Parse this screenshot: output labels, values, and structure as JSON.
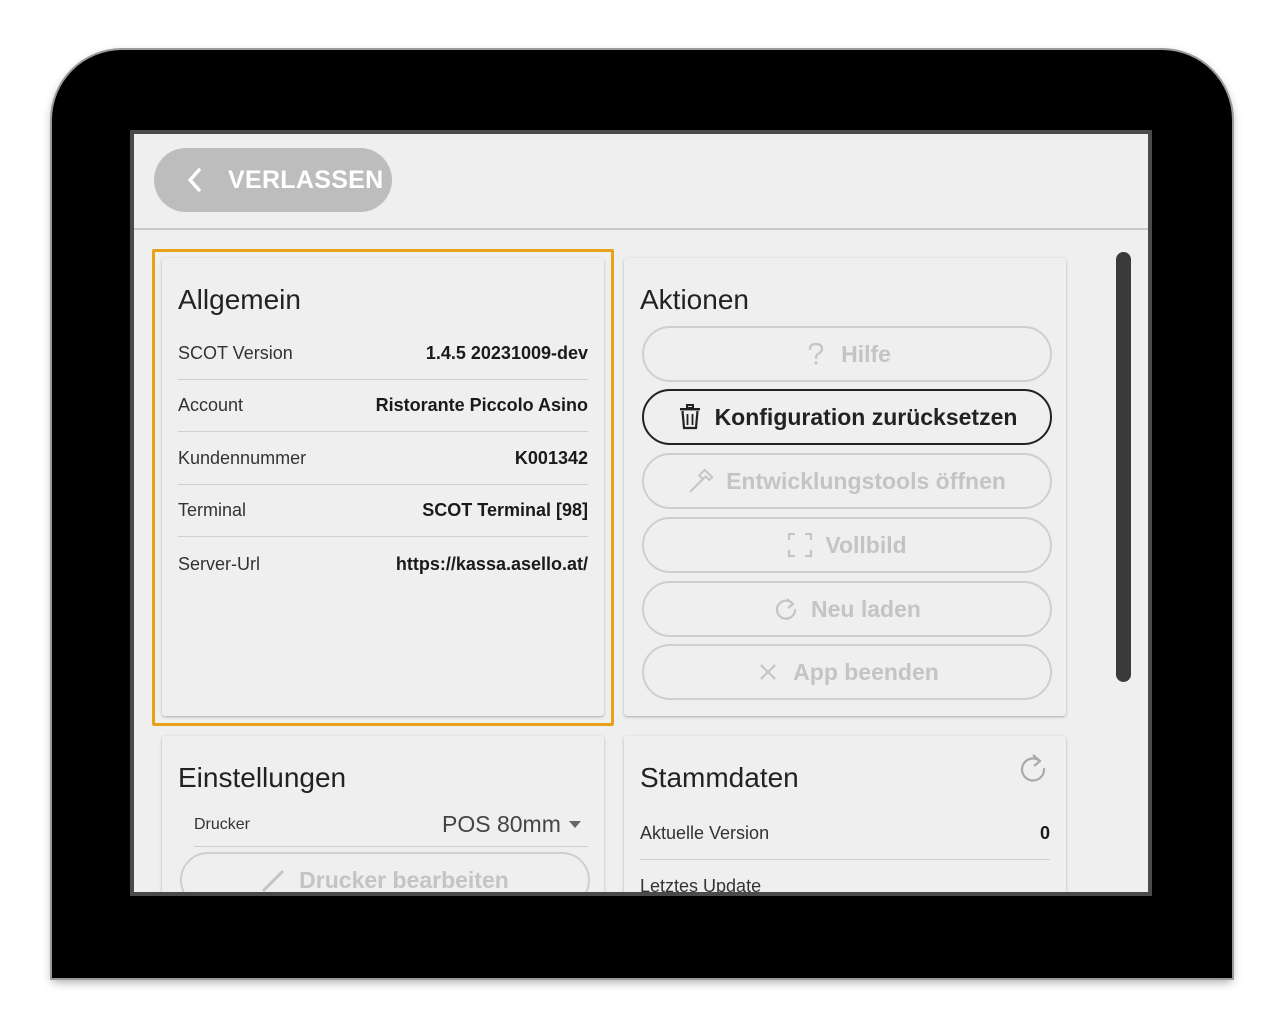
{
  "topbar": {
    "back_label": "VERLASSEN"
  },
  "general": {
    "title": "Allgemein",
    "rows": [
      {
        "label": "SCOT Version",
        "value": "1.4.5 20231009-dev"
      },
      {
        "label": "Account",
        "value": "Ristorante Piccolo Asino"
      },
      {
        "label": "Kundennummer",
        "value": "K001342"
      },
      {
        "label": "Terminal",
        "value": "SCOT Terminal [98]"
      },
      {
        "label": "Server-Url",
        "value": "https://kassa.asello.at/"
      }
    ]
  },
  "actions": {
    "title": "Aktionen",
    "buttons": [
      {
        "label": "Hilfe",
        "icon": "question-icon",
        "enabled": false
      },
      {
        "label": "Konfiguration zurücksetzen",
        "icon": "trash-icon",
        "enabled": true
      },
      {
        "label": "Entwicklungstools öffnen",
        "icon": "hammer-icon",
        "enabled": false
      },
      {
        "label": "Vollbild",
        "icon": "fullscreen-icon",
        "enabled": false
      },
      {
        "label": "Neu laden",
        "icon": "reload-icon",
        "enabled": false
      },
      {
        "label": "App beenden",
        "icon": "close-icon",
        "enabled": false
      }
    ]
  },
  "settings": {
    "title": "Einstellungen",
    "printer_label": "Drucker",
    "printer_value": "POS 80mm",
    "edit_printer_label": "Drucker bearbeiten"
  },
  "masterdata": {
    "title": "Stammdaten",
    "rows": [
      {
        "label": "Aktuelle Version",
        "value": "0"
      },
      {
        "label": "Letztes Update",
        "value": ""
      }
    ]
  },
  "colors": {
    "highlight": "#e8a21a",
    "back_button_bg": "#bdbdbd",
    "disabled_text": "#c4c4c4",
    "screen_bg": "#efefef"
  }
}
